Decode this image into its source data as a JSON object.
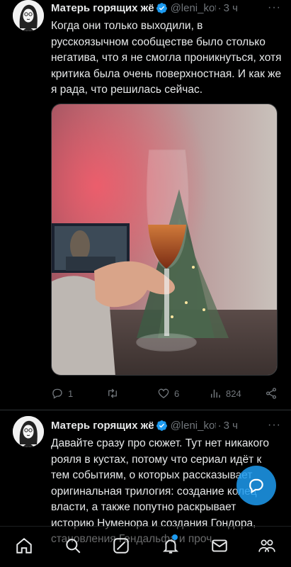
{
  "colors": {
    "accent": "#1d9bf0",
    "muted": "#71767b",
    "background": "#000000",
    "text": "#e7e9ea"
  },
  "tweets": [
    {
      "author": {
        "name": "Матерь горящих жё",
        "handle": "@leni_kotil",
        "separator": "·",
        "time": "3 ч",
        "verified": true
      },
      "more": "···",
      "text": "Когда они только выходили, в русскоязычном сообществе было столько негатива, что я не смогла проникнуться, хотя критика была очень поверхностная. И как же я рада, что решилась сейчас.",
      "media": {
        "type": "photo",
        "description_icon": "wine-glass-photo"
      },
      "actions": {
        "replies": "1",
        "retweets": "",
        "likes": "6",
        "views": "824"
      }
    },
    {
      "author": {
        "name": "Матерь горящих жё",
        "handle": "@leni_kotil",
        "separator": "·",
        "time": "3 ч",
        "verified": true
      },
      "more": "···",
      "text": "Давайте сразу про сюжет. Тут нет никакого рояля в кустах, потому что сериал идёт к тем событиям, о которых рассказывает оригинальная трилогия: создание колец власти, а также попутно раскрывает историю Нуменора и создания Гондора, становления Гендальфа и проч."
    }
  ],
  "bottom_nav": {
    "items": [
      "home-icon",
      "search-icon",
      "grok-icon",
      "notifications-icon",
      "messages-icon",
      "communities-icon"
    ],
    "notifications_badge": true
  },
  "fab": {
    "icon": "compose-icon"
  }
}
